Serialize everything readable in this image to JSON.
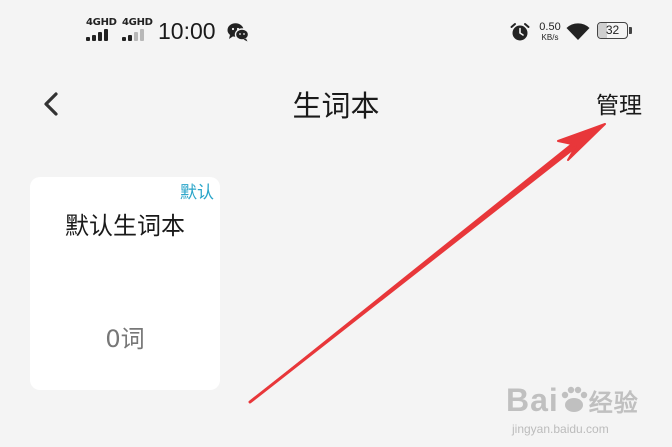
{
  "status_bar": {
    "signal_1": "4GHD",
    "signal_2": "4GHD",
    "time": "10:00",
    "net_speed_value": "0.50",
    "net_speed_unit": "KB/s",
    "battery_level": "32",
    "battery_fraction": 0.32,
    "icons": [
      "signal-icon",
      "wechat-icon",
      "alarm-icon",
      "wifi-icon",
      "battery-icon"
    ]
  },
  "nav": {
    "back_icon": "chevron-left-icon",
    "title": "生词本",
    "manage_label": "管理"
  },
  "wordbooks": [
    {
      "badge": "默认",
      "name": "默认生词本",
      "count": "0词"
    }
  ],
  "watermark": {
    "brand": "Bai",
    "brand_end": "经验",
    "sub": "jingyan.baidu.com"
  },
  "colors": {
    "background": "#f4f4f4",
    "card": "#ffffff",
    "badge": "#2aa5c9",
    "annotation_arrow": "#e8373a"
  }
}
